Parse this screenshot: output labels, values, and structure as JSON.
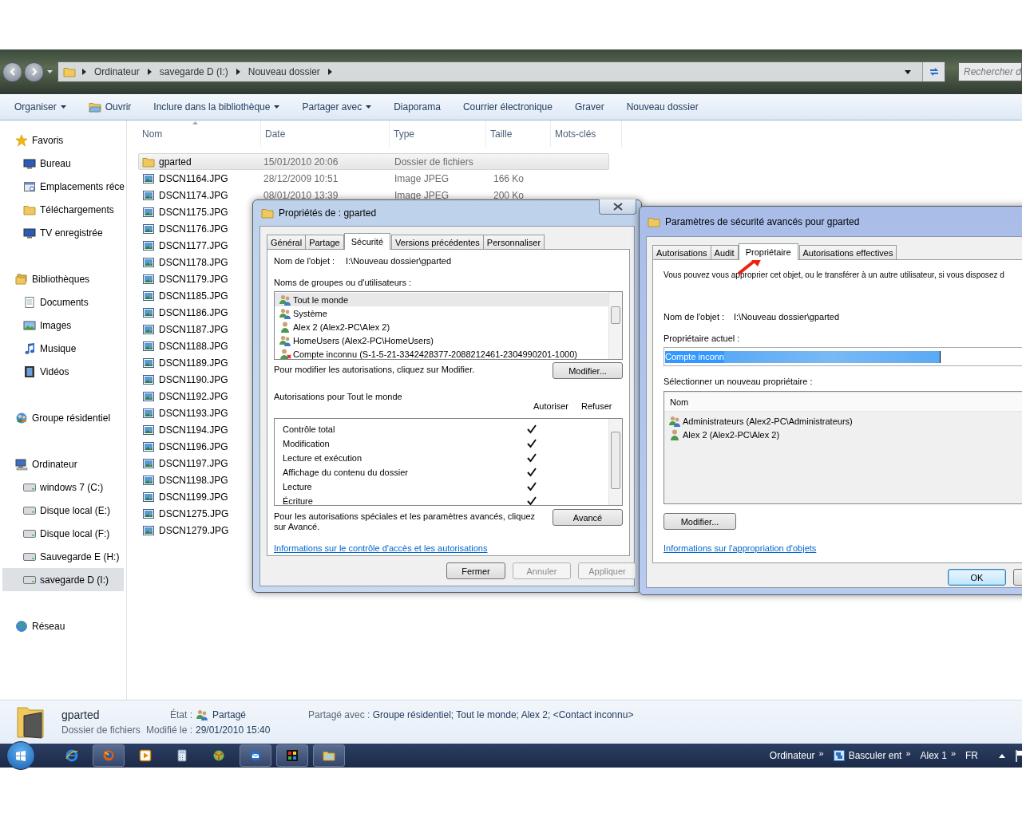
{
  "address_bar": {
    "crumbs": [
      "Ordinateur",
      "savegarde D (I:)",
      "Nouveau dossier"
    ]
  },
  "search": {
    "placeholder": "Rechercher d"
  },
  "toolbar": [
    {
      "label": "Organiser",
      "kind": "dropdown"
    },
    {
      "label": "Ouvrir",
      "kind": "icon"
    },
    {
      "label": "Inclure dans la bibliothèque",
      "kind": "dropdown"
    },
    {
      "label": "Partager avec",
      "kind": "dropdown"
    },
    {
      "label": "Diaporama",
      "kind": "plain"
    },
    {
      "label": "Courrier électronique",
      "kind": "plain"
    },
    {
      "label": "Graver",
      "kind": "plain"
    },
    {
      "label": "Nouveau dossier",
      "kind": "plain"
    }
  ],
  "sidebar": [
    {
      "label": "Favoris",
      "kind": "star",
      "children": [
        {
          "label": "Bureau",
          "kind": "monitor",
          "selected": false
        },
        {
          "label": "Emplacements réce",
          "kind": "window",
          "selected": false
        },
        {
          "label": "Téléchargements",
          "kind": "folder",
          "selected": false
        },
        {
          "label": "TV enregistrée",
          "kind": "monitor",
          "selected": false
        }
      ]
    },
    {
      "label": "Bibliothèques",
      "kind": "folders",
      "children": [
        {
          "label": "Documents",
          "kind": "document",
          "selected": false
        },
        {
          "label": "Images",
          "kind": "picture",
          "selected": false
        },
        {
          "label": "Musique",
          "kind": "note",
          "selected": false
        },
        {
          "label": "Vidéos",
          "kind": "film",
          "selected": false
        }
      ]
    },
    {
      "label": "Groupe résidentiel",
      "kind": "people"
    },
    {
      "label": "Ordinateur",
      "kind": "computer",
      "children": [
        {
          "label": "windows 7 (C:)",
          "kind": "drive",
          "selected": false
        },
        {
          "label": "Disque local (E:)",
          "kind": "drive",
          "selected": false
        },
        {
          "label": "Disque local (F:)",
          "kind": "drive",
          "selected": false
        },
        {
          "label": "Sauvegarde  E (H:)",
          "kind": "drive",
          "selected": false
        },
        {
          "label": "savegarde D (I:)",
          "kind": "drive",
          "selected": true
        }
      ]
    },
    {
      "label": "Réseau",
      "kind": "globe"
    }
  ],
  "file_list": {
    "columns": [
      "Nom",
      "Date",
      "Type",
      "Taille",
      "Mots-clés"
    ],
    "rows": [
      {
        "name": "gparted",
        "kind": "folder",
        "date": "15/01/2010 20:06",
        "type": "Dossier de fichiers",
        "selected": true
      },
      {
        "name": "DSCN1164.JPG",
        "kind": "image",
        "date": "28/12/2009 10:51",
        "type": "Image JPEG",
        "size": "166 Ko",
        "selected": false
      },
      {
        "name": "DSCN1174.JPG",
        "kind": "image",
        "date": "08/01/2010 13:39",
        "type": "Image JPEG",
        "size": "200 Ko",
        "selected": false
      },
      {
        "name": "DSCN1175.JPG",
        "kind": "image",
        "selected": false
      },
      {
        "name": "DSCN1176.JPG",
        "kind": "image",
        "selected": false
      },
      {
        "name": "DSCN1177.JPG",
        "kind": "image",
        "selected": false
      },
      {
        "name": "DSCN1178.JPG",
        "kind": "image",
        "selected": false
      },
      {
        "name": "DSCN1179.JPG",
        "kind": "image",
        "selected": false
      },
      {
        "name": "DSCN1185.JPG",
        "kind": "image",
        "selected": false
      },
      {
        "name": "DSCN1186.JPG",
        "kind": "image",
        "selected": false
      },
      {
        "name": "DSCN1187.JPG",
        "kind": "image",
        "selected": false
      },
      {
        "name": "DSCN1188.JPG",
        "kind": "image",
        "selected": false
      },
      {
        "name": "DSCN1189.JPG",
        "kind": "image",
        "selected": false
      },
      {
        "name": "DSCN1190.JPG",
        "kind": "image",
        "selected": false
      },
      {
        "name": "DSCN1192.JPG",
        "kind": "image",
        "selected": false
      },
      {
        "name": "DSCN1193.JPG",
        "kind": "image",
        "selected": false
      },
      {
        "name": "DSCN1194.JPG",
        "kind": "image",
        "selected": false
      },
      {
        "name": "DSCN1196.JPG",
        "kind": "image",
        "selected": false
      },
      {
        "name": "DSCN1197.JPG",
        "kind": "image",
        "selected": false
      },
      {
        "name": "DSCN1198.JPG",
        "kind": "image",
        "selected": false
      },
      {
        "name": "DSCN1199.JPG",
        "kind": "image",
        "selected": false
      },
      {
        "name": "DSCN1275.JPG",
        "kind": "image",
        "selected": false
      },
      {
        "name": "DSCN1279.JPG",
        "kind": "image",
        "selected": false
      }
    ]
  },
  "details": {
    "name": "gparted",
    "type": "Dossier de fichiers",
    "state_label": "État :",
    "state": "Partagé",
    "modified_label": "Modifié le :",
    "modified": "29/01/2010 15:40",
    "shared_label": "Partagé avec :",
    "shared": "Groupe résidentiel; Tout le monde; Alex 2; <Contact inconnu>"
  },
  "properties_dialog": {
    "title": "Propriétés de : gparted",
    "tabs": [
      {
        "label": "Général",
        "selected": false
      },
      {
        "label": "Partage",
        "selected": false
      },
      {
        "label": "Sécurité",
        "selected": true
      },
      {
        "label": "Versions précédentes",
        "selected": false
      },
      {
        "label": "Personnaliser",
        "selected": false
      }
    ],
    "object_label": "Nom de l'objet :",
    "object_value": "I:\\Nouveau dossier\\gparted",
    "users_label": "Noms de groupes ou d'utilisateurs :",
    "users": [
      {
        "name": "Tout le monde",
        "kind": "group",
        "selected": true
      },
      {
        "name": "Système",
        "kind": "group",
        "selected": false
      },
      {
        "name": "Alex 2 (Alex2-PC\\Alex 2)",
        "kind": "user",
        "selected": false
      },
      {
        "name": "HomeUsers (Alex2-PC\\HomeUsers)",
        "kind": "group",
        "selected": false
      },
      {
        "name": "Compte inconnu (S-1-5-21-3342428377-2088212461-2304990201-1000)",
        "kind": "unknown",
        "selected": false
      }
    ],
    "modify_hint": "Pour modifier les autorisations, cliquez sur Modifier.",
    "modify_button": "Modifier...",
    "permissions_label": "Autorisations pour Tout le monde",
    "allow_header": "Autoriser",
    "deny_header": "Refuser",
    "permissions": [
      {
        "name": "Contrôle total",
        "allow": true,
        "deny": false
      },
      {
        "name": "Modification",
        "allow": true,
        "deny": false
      },
      {
        "name": "Lecture et exécution",
        "allow": true,
        "deny": false
      },
      {
        "name": "Affichage du contenu du dossier",
        "allow": true,
        "deny": false
      },
      {
        "name": "Lecture",
        "allow": true,
        "deny": false
      },
      {
        "name": "Écriture",
        "allow": true,
        "deny": false
      }
    ],
    "advanced_hint": "Pour les autorisations spéciales et les paramètres avancés, cliquez sur Avancé.",
    "advanced_button": "Avancé",
    "link": "Informations sur le contrôle d'accès et les autorisations",
    "buttons": [
      {
        "label": "Fermer",
        "disabled": false
      },
      {
        "label": "Annuler",
        "disabled": true
      },
      {
        "label": "Appliquer",
        "disabled": true
      }
    ]
  },
  "advanced_dialog": {
    "title": "Paramètres de sécurité avancés pour gparted",
    "tabs": [
      {
        "label": "Autorisations",
        "selected": false
      },
      {
        "label": "Audit",
        "selected": false
      },
      {
        "label": "Propriétaire",
        "selected": true
      },
      {
        "label": "Autorisations effectives",
        "selected": false
      }
    ],
    "intro": "Vous pouvez vous approprier cet objet, ou le transférer à un autre utilisateur, si vous disposez d",
    "object_label": "Nom de l'objet :",
    "object_value": "I:\\Nouveau dossier\\gparted",
    "owner_label": "Propriétaire actuel :",
    "owner_value": "Compte inconn",
    "new_owner_label": "Sélectionner un nouveau propriétaire :",
    "list_header": "Nom",
    "owners": [
      {
        "name": "Administrateurs (Alex2-PC\\Administrateurs)",
        "kind": "group"
      },
      {
        "name": "Alex 2 (Alex2-PC\\Alex 2)",
        "kind": "user"
      }
    ],
    "modify_button": "Modifier...",
    "link": "Informations sur l'appropriation d'objets",
    "ok_button": "OK"
  },
  "taskbar": {
    "apps": [
      {
        "kind": "ie",
        "running": false
      },
      {
        "kind": "firefox",
        "running": true
      },
      {
        "kind": "media",
        "running": false
      },
      {
        "kind": "calc",
        "running": false
      },
      {
        "kind": "orb",
        "running": false
      },
      {
        "kind": "mail",
        "running": true
      },
      {
        "kind": "grid",
        "running": true
      },
      {
        "kind": "explorer",
        "running": true
      }
    ],
    "toolbars": [
      {
        "label": "Ordinateur",
        "chevron": "»",
        "icon": false
      },
      {
        "label": "Basculer ent",
        "chevron": "»",
        "icon": true
      },
      {
        "label": "Alex 1",
        "chevron": "»",
        "icon": false
      }
    ],
    "language": "FR"
  }
}
